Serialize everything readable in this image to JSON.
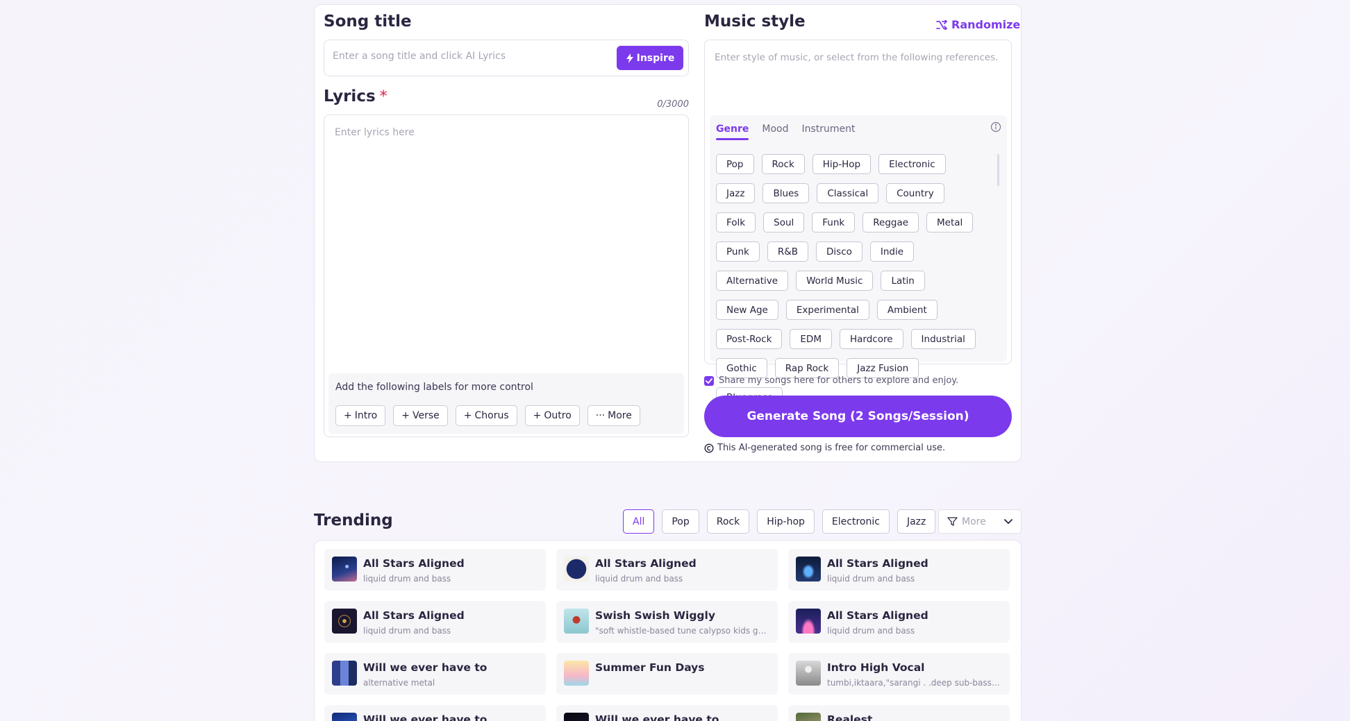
{
  "song_title": {
    "label": "Song title",
    "placeholder": "Enter a song title and click AI Lyrics",
    "inspire_label": "Inspire"
  },
  "lyrics": {
    "label": "Lyrics",
    "required_mark": "*",
    "counter": "0/3000",
    "placeholder": "Enter lyrics here",
    "labels_hint": "Add the following labels for more control",
    "label_buttons": [
      "Intro",
      "Verse",
      "Chorus",
      "Outro",
      "More"
    ]
  },
  "music_style": {
    "label": "Music style",
    "randomize_label": "Randomize",
    "placeholder": "Enter style of music, or select from the following references.",
    "tabs": [
      "Genre",
      "Mood",
      "Instrument"
    ],
    "active_tab": "Genre",
    "genres": [
      "Pop",
      "Rock",
      "Hip-Hop",
      "Electronic",
      "Jazz",
      "Blues",
      "Classical",
      "Country",
      "Folk",
      "Soul",
      "Funk",
      "Reggae",
      "Metal",
      "Punk",
      "R&B",
      "Disco",
      "Indie",
      "Alternative",
      "World Music",
      "Latin",
      "New Age",
      "Experimental",
      "Ambient",
      "Post-Rock",
      "EDM",
      "Hardcore",
      "Industrial",
      "Gothic",
      "Rap Rock",
      "Jazz Fusion",
      "Bluegrass"
    ]
  },
  "share": {
    "label": "Share my songs here for others to explore and enjoy.",
    "checked": true
  },
  "generate_label": "Generate Song (2 Songs/Session)",
  "commercial_note": "This AI-generated song is free for commercial use.",
  "trending": {
    "title": "Trending",
    "filters": [
      "All",
      "Pop",
      "Rock",
      "Hip-hop",
      "Electronic",
      "Jazz"
    ],
    "active_filter": "All",
    "more_placeholder": "More",
    "songs": [
      {
        "title": "All Stars Aligned",
        "subtitle": "liquid drum and bass",
        "thumb": "starry-sky"
      },
      {
        "title": "All Stars Aligned",
        "subtitle": "liquid drum and bass",
        "thumb": "ornament-circle"
      },
      {
        "title": "All Stars Aligned",
        "subtitle": "liquid drum and bass",
        "thumb": "blue-figure"
      },
      {
        "title": "All Stars Aligned",
        "subtitle": "liquid drum and bass",
        "thumb": "mandala"
      },
      {
        "title": "Swish Swish Wiggly",
        "subtitle": "\"soft whistle-based tune calypso kids gr…",
        "thumb": "dancer"
      },
      {
        "title": "All Stars Aligned",
        "subtitle": "liquid drum and bass",
        "thumb": "concert-stage"
      },
      {
        "title": "Will we ever have to",
        "subtitle": "alternative metal",
        "thumb": "city-tiles"
      },
      {
        "title": "Summer Fun Days",
        "subtitle": "",
        "thumb": "summer-poster"
      },
      {
        "title": "Intro High Vocal",
        "subtitle": "tumbi,iktaara,\"sarangi . .deep sub-bass …",
        "thumb": "microphone"
      },
      {
        "title": "Will we ever have to",
        "subtitle": "",
        "thumb": "blue-night"
      },
      {
        "title": "Will we ever have to",
        "subtitle": "",
        "thumb": "dark-night"
      },
      {
        "title": "Realest",
        "subtitle": "",
        "thumb": "green-portrait"
      }
    ]
  },
  "colors": {
    "accent": "#7c3aed",
    "required": "#e11d48"
  }
}
